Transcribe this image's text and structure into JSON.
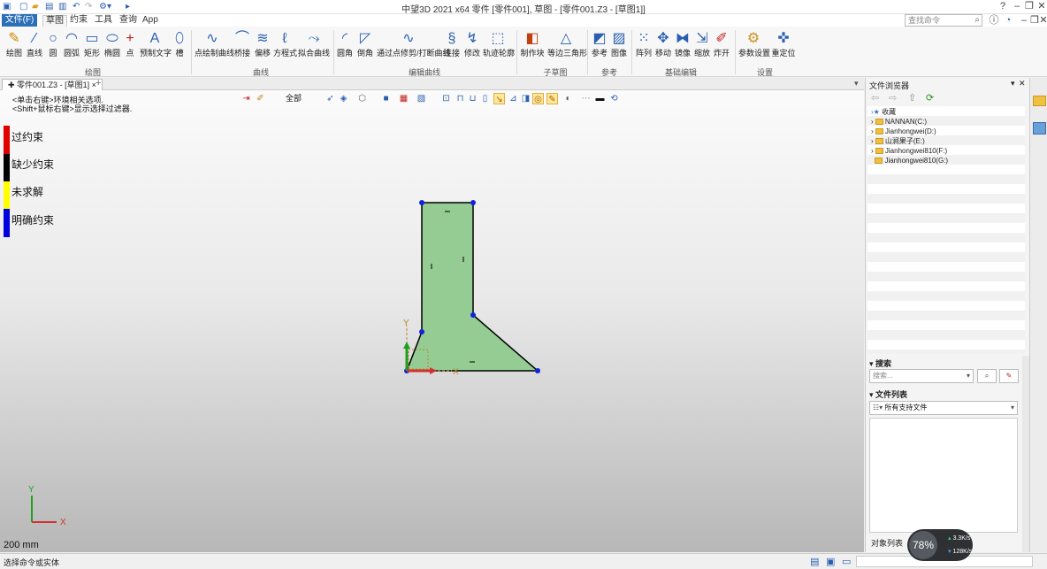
{
  "window": {
    "title": "中望3D 2021 x64        零件 [零件001], 草图 - [零件001.Z3 - [草图1]]"
  },
  "menu": {
    "file": "文件(F)",
    "items": [
      "草图",
      "约束",
      "工具",
      "查询",
      "App"
    ],
    "search_placeholder": "查找命令"
  },
  "ribbon": {
    "tools": [
      "绘图",
      "直线",
      "圆",
      "圆弧",
      "矩形",
      "椭圆",
      "点",
      "预制文字",
      "槽",
      "点绘制曲线",
      "桥接",
      "偏移",
      "方程式",
      "拟合曲线",
      "圆角",
      "倒角",
      "通过点修剪/打断曲线",
      "连接",
      "修改",
      "轨迹轮廓",
      "制作块",
      "等边三角形",
      "参考",
      "图像",
      "阵列",
      "移动",
      "镜像",
      "缩放",
      "炸开",
      "参数设置",
      "重定位"
    ],
    "groups": [
      "绘图",
      "曲线",
      "编辑曲线",
      "子草图",
      "参考",
      "基础编辑",
      "设置"
    ]
  },
  "doc_tab": {
    "label": "零件001.Z3 - [草图1]",
    "close": "×",
    "new_tab": "+"
  },
  "viewport": {
    "hint_line1": "<单击右键>环境相关选项.",
    "hint_line2": "<Shift+鼠标右键>显示选择过滤器.",
    "filter": "全部",
    "legend": [
      {
        "label": "过约束",
        "color": "#e00000"
      },
      {
        "label": "缺少约束",
        "color": "#000000"
      },
      {
        "label": "未求解",
        "color": "#ffff00"
      },
      {
        "label": "明确约束",
        "color": "#0000e0"
      }
    ],
    "axis_x": "X",
    "axis_y": "Y",
    "scale": "200 mm"
  },
  "colors": {
    "sketch_fill": "#94cc94",
    "vertex": "#1122dd",
    "x_axis": "#d03030",
    "y_axis": "#20a020",
    "ribbon_accent": "#2a5fb0"
  },
  "file_browser": {
    "title": "文件浏览器",
    "tree": [
      "收藏",
      "NANNAN(C:)",
      "Jianhongwei(D:)",
      "山涧果子(E:)",
      "Jianhongwei810(F:)",
      "Jianhongwei810(G:)"
    ],
    "search_title": "搜索",
    "search_placeholder": "搜索...",
    "file_list_title": "文件列表",
    "file_filter": "所有支持文件",
    "object_list": "对象列表"
  },
  "status": {
    "text": "选择命令或实体"
  },
  "perf_widget": {
    "cpu": "78%",
    "up": "3.3K/s",
    "down": "128K/s"
  }
}
